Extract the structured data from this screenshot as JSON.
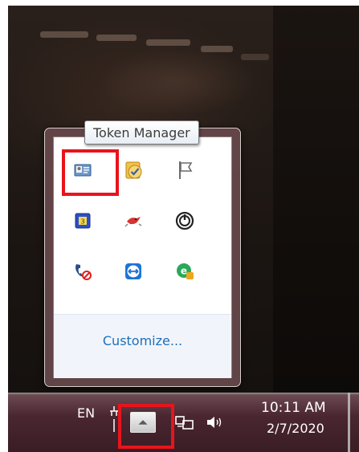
{
  "tooltip": {
    "text": "Token Manager"
  },
  "flyout": {
    "customize_label": "Customize...",
    "icons": [
      {
        "name": "token-manager-icon"
      },
      {
        "name": "schedule-check-icon"
      },
      {
        "name": "action-center-flag-icon"
      },
      {
        "name": "yellow-box-app-icon"
      },
      {
        "name": "red-bird-app-icon"
      },
      {
        "name": "power-dial-icon"
      },
      {
        "name": "phone-blocked-icon"
      },
      {
        "name": "teamviewer-icon"
      },
      {
        "name": "e-app-icon"
      }
    ]
  },
  "taskbar": {
    "language": "EN",
    "show_hidden_icons": "show-hidden-icons-arrow",
    "clock": {
      "time": "10:11 AM",
      "date": "2/7/2020"
    }
  },
  "colors": {
    "highlight": "#e8141c",
    "link": "#1e6fb8",
    "taskbar": "#3a1d24"
  }
}
